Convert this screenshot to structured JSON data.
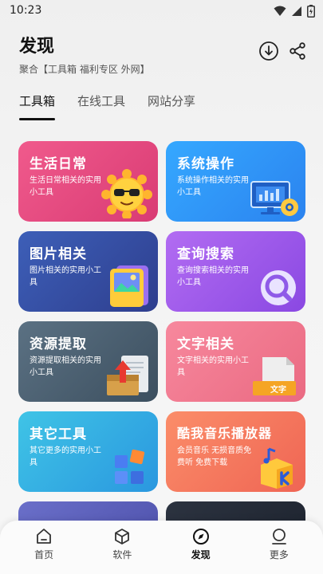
{
  "status": {
    "time": "10:23"
  },
  "header": {
    "title": "发现",
    "subtitle": "聚合【工具箱 福利专区 外网】"
  },
  "tabs": [
    {
      "label": "工具箱",
      "active": true
    },
    {
      "label": "在线工具",
      "active": false
    },
    {
      "label": "网站分享",
      "active": false
    }
  ],
  "cards": [
    {
      "title": "生活日常",
      "desc": "生活日常相关的实用小工具",
      "icon": "sun-sunglasses-icon"
    },
    {
      "title": "系统操作",
      "desc": "系统操作相关的实用小工具",
      "icon": "monitor-gear-icon"
    },
    {
      "title": "图片相关",
      "desc": "图片相关的实用小工具",
      "icon": "picture-icon"
    },
    {
      "title": "查询搜索",
      "desc": "查询搜索相关的实用小工具",
      "icon": "magnifier-icon"
    },
    {
      "title": "资源提取",
      "desc": "资源提取相关的实用小工具",
      "icon": "box-extract-icon"
    },
    {
      "title": "文字相关",
      "desc": "文字相关的实用小工具",
      "icon": "document-text-icon",
      "badge": "文字"
    },
    {
      "title": "其它工具",
      "desc": "其它更多的实用小工具",
      "icon": "blocks-icon"
    },
    {
      "title": "酷我音乐播放器",
      "desc": "会员音乐 无损音质免费听 免费下载",
      "icon": "kuwo-music-icon"
    }
  ],
  "bottom_nav": [
    {
      "label": "首页",
      "icon": "home-icon",
      "active": false
    },
    {
      "label": "软件",
      "icon": "cube-icon",
      "active": false
    },
    {
      "label": "发现",
      "icon": "compass-icon",
      "active": true
    },
    {
      "label": "更多",
      "icon": "more-icon",
      "active": false
    }
  ],
  "colors": {
    "background": "#f2f2f2",
    "text_primary": "#111111",
    "card_life": "#e94a80",
    "card_system": "#2f95f6",
    "card_image": "#34499e",
    "card_search": "#9c5aea",
    "card_resource": "#4b5f70",
    "card_text": "#f07a90",
    "card_other": "#33acE3",
    "card_kuwo": "#f5785e"
  }
}
